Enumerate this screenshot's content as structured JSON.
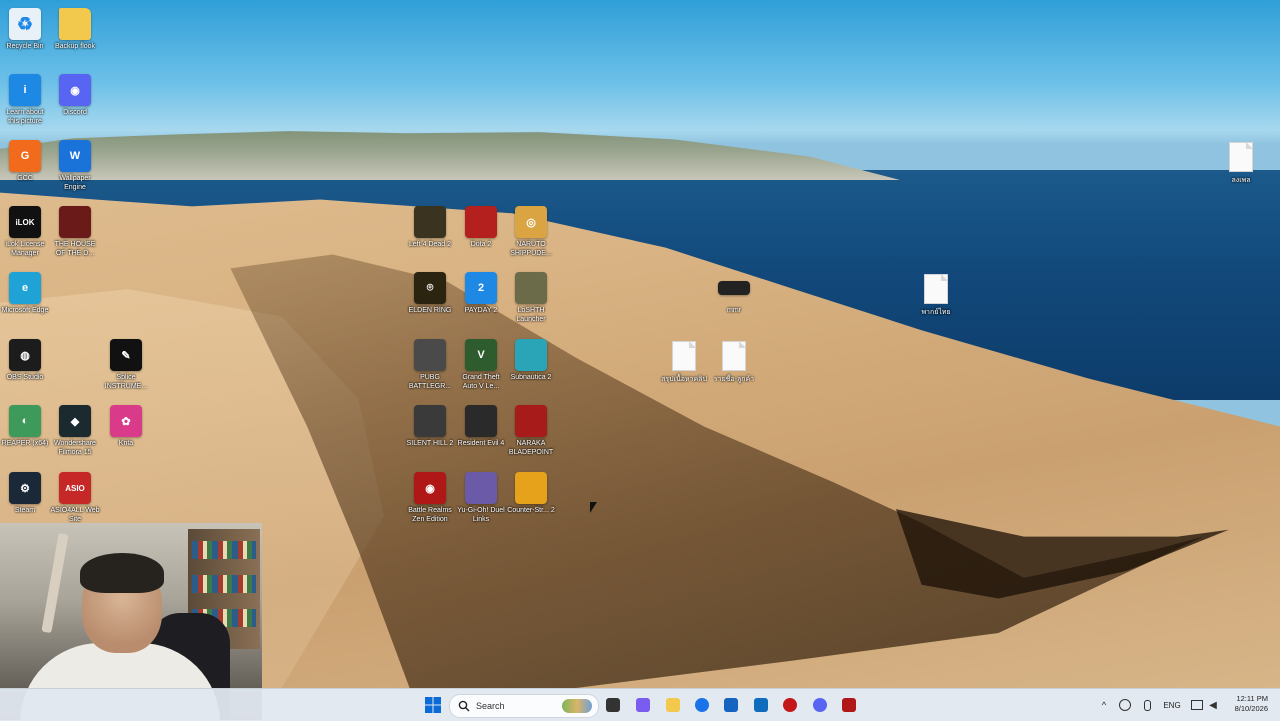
{
  "desktop": {
    "icons": [
      {
        "label": "Recycle Bin",
        "icon": "recycle-bin-icon",
        "color": "#e8f0f8",
        "glyph": "♻"
      },
      {
        "label": "Backup flook",
        "icon": "folder-icon",
        "color": "#f2c94c",
        "glyph": ""
      },
      {
        "label": "Learn about this picture",
        "icon": "info-icon",
        "color": "#1e88e5",
        "glyph": "i"
      },
      {
        "label": "Discord",
        "icon": "discord-icon",
        "color": "#5865f2",
        "glyph": "◉"
      },
      {
        "label": "GCC",
        "icon": "gcc-icon",
        "color": "#f26a1b",
        "glyph": "G"
      },
      {
        "label": "Wallpaper Engine",
        "icon": "wallpaper-engine-icon",
        "color": "#1a73d9",
        "glyph": "W"
      },
      {
        "label": "iLok License Manager",
        "icon": "ilok-icon",
        "color": "#111111",
        "glyph": "iLOK"
      },
      {
        "label": "THE HOUSE OF THE D...",
        "icon": "game-icon",
        "color": "#6b1a1a",
        "glyph": ""
      },
      {
        "label": "Microsoft Edge",
        "icon": "edge-icon",
        "color": "#1fa3d6",
        "glyph": "e"
      },
      {
        "label": "OBS Studio",
        "icon": "obs-icon",
        "color": "#1c1c1c",
        "glyph": "◍"
      },
      {
        "label": "Splice INSTRUME...",
        "icon": "splice-icon",
        "color": "#111111",
        "glyph": "✎"
      },
      {
        "label": "REAPER (x64)",
        "icon": "reaper-icon",
        "color": "#3d9a5a",
        "glyph": "◐"
      },
      {
        "label": "Wondershare Filmora 15",
        "icon": "filmora-icon",
        "color": "#1b2a2f",
        "glyph": "◆"
      },
      {
        "label": "Krita",
        "icon": "krita-icon",
        "color": "#d93a8a",
        "glyph": "✿"
      },
      {
        "label": "Steam",
        "icon": "steam-icon",
        "color": "#1b2838",
        "glyph": "⚙"
      },
      {
        "label": "ASIO4ALL Web Site",
        "icon": "asio-icon",
        "color": "#c62828",
        "glyph": "ASIO"
      },
      {
        "label": "Left 4 Dead 2",
        "icon": "game-icon",
        "color": "#3a3320",
        "glyph": ""
      },
      {
        "label": "Dota 2",
        "icon": "dota-icon",
        "color": "#b3201e",
        "glyph": ""
      },
      {
        "label": "NARUTO SHIPPUDE...",
        "icon": "naruto-icon",
        "color": "#d9a441",
        "glyph": "◎"
      },
      {
        "label": "ELDEN RING",
        "icon": "elden-ring-icon",
        "color": "#2b2410",
        "glyph": "⌾"
      },
      {
        "label": "PAYDAY 2",
        "icon": "payday-icon",
        "color": "#1e88e5",
        "glyph": "2"
      },
      {
        "label": "LoSHTH Launcher",
        "icon": "launcher-icon",
        "color": "#6b6b4a",
        "glyph": ""
      },
      {
        "label": "PUBG BATTLEGR...",
        "icon": "pubg-icon",
        "color": "#4a4a4a",
        "glyph": ""
      },
      {
        "label": "Grand Theft Auto V Le...",
        "icon": "gta-icon",
        "color": "#2e5c2e",
        "glyph": "V"
      },
      {
        "label": "Subnautica 2",
        "icon": "subnautica-icon",
        "color": "#2aa5b8",
        "glyph": ""
      },
      {
        "label": "SILENT HILL 2",
        "icon": "silent-hill-icon",
        "color": "#3a3a3a",
        "glyph": ""
      },
      {
        "label": "Resident Evil 4",
        "icon": "resident-evil-icon",
        "color": "#2a2a2a",
        "glyph": ""
      },
      {
        "label": "NARAKA BLADEPOINT",
        "icon": "naraka-icon",
        "color": "#a81b1b",
        "glyph": ""
      },
      {
        "label": "Battle Realms Zen Edition",
        "icon": "battle-realms-icon",
        "color": "#b01818",
        "glyph": "◉"
      },
      {
        "label": "Yu-Gi-Oh! Duel Links",
        "icon": "yugioh-icon",
        "color": "#6a5aa8",
        "glyph": ""
      },
      {
        "label": "Counter-Str... 2",
        "icon": "counter-strike-icon",
        "color": "#e6a21a",
        "glyph": ""
      },
      {
        "label": "ลงเพล",
        "icon": "file-icon",
        "color": "#fafafa",
        "glyph": ""
      },
      {
        "label": "mmr",
        "icon": "file-dark-icon",
        "color": "#222222",
        "glyph": ""
      },
      {
        "label": "พากย์ไทย",
        "icon": "file-icon",
        "color": "#fafafa",
        "glyph": ""
      },
      {
        "label": "สรุปเนื้อหาคลิป",
        "icon": "file-icon",
        "color": "#fafafa",
        "glyph": ""
      },
      {
        "label": "รายชื่อ-ลูกค้า",
        "icon": "file-icon",
        "color": "#fafafa",
        "glyph": ""
      }
    ]
  },
  "taskbar": {
    "search_label": "Search",
    "language": "ENG",
    "time": "12:11 PM",
    "date": "8/10/2026",
    "pinned": [
      {
        "icon": "start-icon",
        "color": "#0a6ad6"
      },
      {
        "icon": "task-view-icon",
        "color": "#333333"
      },
      {
        "icon": "copilot-icon",
        "color": "#7a5cf0"
      },
      {
        "icon": "file-explorer-icon",
        "color": "#f2c94c"
      },
      {
        "icon": "chrome-icon",
        "color": "#1a73e8"
      },
      {
        "icon": "calculator-icon",
        "color": "#1565c0"
      },
      {
        "icon": "outlook-icon",
        "color": "#0f6cbd"
      },
      {
        "icon": "record-icon",
        "color": "#c41818"
      },
      {
        "icon": "discord-icon",
        "color": "#5865f2"
      },
      {
        "icon": "app-icon",
        "color": "#b01818"
      }
    ]
  }
}
